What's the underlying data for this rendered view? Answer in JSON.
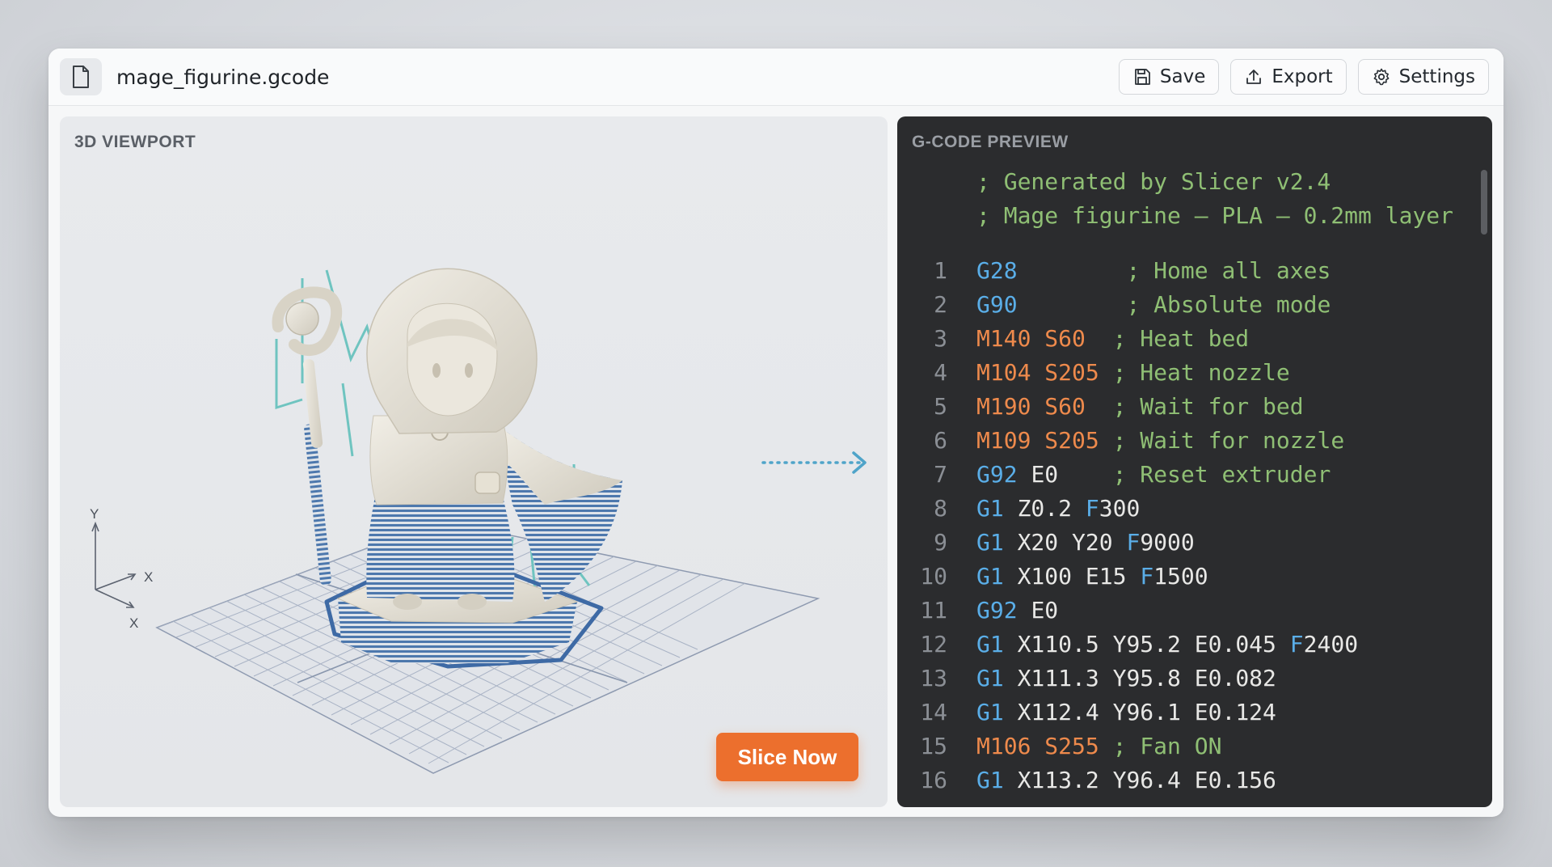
{
  "app": {
    "file_name": "mage_figurine.gcode"
  },
  "toolbar": {
    "save_label": "Save",
    "export_label": "Export",
    "settings_label": "Settings"
  },
  "viewport": {
    "title": "3D VIEWPORT",
    "axis_labels": {
      "y": "Y",
      "x_upper": "X",
      "x_lower": "X"
    },
    "slice_button_label": "Slice Now"
  },
  "gcode_preview": {
    "title": "G-CODE PREVIEW",
    "header_comments": [
      "; Generated by Slicer v2.4",
      "; Mage figurine — PLA — 0.2mm layer"
    ],
    "lines": [
      {
        "num": "1",
        "cmd": "G28",
        "args": "",
        "comment": "; Home all axes"
      },
      {
        "num": "2",
        "cmd": "G90",
        "args": "",
        "comment": "; Absolute mode"
      },
      {
        "num": "3",
        "cmd": "M140",
        "args": "S60",
        "comment": "; Heat bed"
      },
      {
        "num": "4",
        "cmd": "M104",
        "args": "S205",
        "comment": "; Heat nozzle"
      },
      {
        "num": "5",
        "cmd": "M190",
        "args": "S60",
        "comment": "; Wait for bed"
      },
      {
        "num": "6",
        "cmd": "M109",
        "args": "S205",
        "comment": "; Wait for nozzle"
      },
      {
        "num": "7",
        "cmd": "G92",
        "args": "E0",
        "comment": "; Reset extruder"
      },
      {
        "num": "8",
        "cmd": "G1",
        "args": "Z0.2 F300",
        "comment": ""
      },
      {
        "num": "9",
        "cmd": "G1",
        "args": "X20 Y20 F9000",
        "comment": ""
      },
      {
        "num": "10",
        "cmd": "G1",
        "args": "X100 E15 F1500",
        "comment": ""
      },
      {
        "num": "11",
        "cmd": "G92",
        "args": "E0",
        "comment": ""
      },
      {
        "num": "12",
        "cmd": "G1",
        "args": "X110.5 Y95.2 E0.045 F2400",
        "comment": ""
      },
      {
        "num": "13",
        "cmd": "G1",
        "args": "X111.3 Y95.8 E0.082",
        "comment": ""
      },
      {
        "num": "14",
        "cmd": "G1",
        "args": "X112.4 Y96.1 E0.124",
        "comment": ""
      },
      {
        "num": "15",
        "cmd": "M106",
        "args": "S255",
        "comment": "; Fan ON"
      },
      {
        "num": "16",
        "cmd": "G1",
        "args": "X113.2 Y96.4 E0.156",
        "comment": ""
      }
    ]
  },
  "colors": {
    "accent_orange": "#ec6f2d",
    "gcode_command_g": "#5aaee8",
    "gcode_command_m": "#ee8a4c",
    "gcode_comment": "#8fbf74",
    "gcode_background": "#2b2c2e",
    "print_layer_blue": "#3f6fa8",
    "support_teal": "#6fc4c0"
  }
}
